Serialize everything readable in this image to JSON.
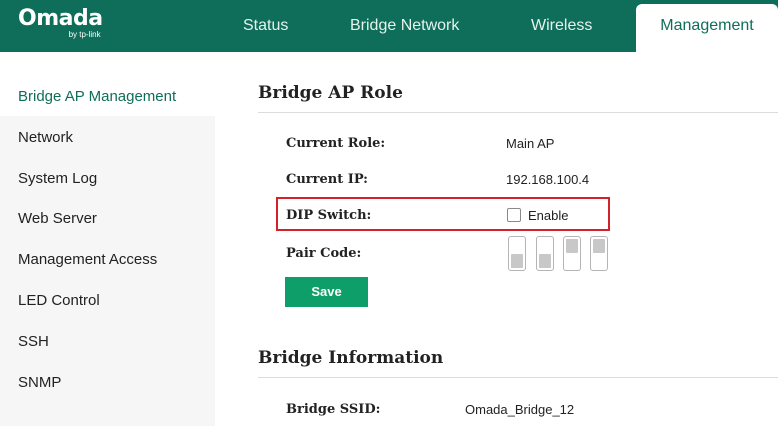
{
  "brand": {
    "name": "Omada",
    "sub": "by tp-link"
  },
  "nav": {
    "tabs": [
      {
        "label": "Status"
      },
      {
        "label": "Bridge Network"
      },
      {
        "label": "Wireless"
      },
      {
        "label": "Management"
      }
    ],
    "active": "Management"
  },
  "sidebar": {
    "items": [
      {
        "label": "Bridge AP Management"
      },
      {
        "label": "Network"
      },
      {
        "label": "System Log"
      },
      {
        "label": "Web Server"
      },
      {
        "label": "Management Access"
      },
      {
        "label": "LED Control"
      },
      {
        "label": "SSH"
      },
      {
        "label": "SNMP"
      }
    ],
    "active": "Bridge AP Management"
  },
  "role_section": {
    "title": "Bridge AP Role",
    "current_role_label": "Current Role:",
    "current_role_value": "Main AP",
    "current_ip_label": "Current IP:",
    "current_ip_value": "192.168.100.4",
    "dip_switch_label": "DIP Switch:",
    "dip_switch_option": "Enable",
    "dip_switch_checked": false,
    "pair_code_label": "Pair Code:",
    "pair_code_switches": [
      "down",
      "down",
      "up",
      "up"
    ],
    "save_label": "Save"
  },
  "info_section": {
    "title": "Bridge Information",
    "bridge_ssid_label": "Bridge SSID:",
    "bridge_ssid_value": "Omada_Bridge_12"
  },
  "colors": {
    "header": "#0e6e59",
    "accent": "#0e9e6a",
    "highlight": "#d4222a"
  }
}
